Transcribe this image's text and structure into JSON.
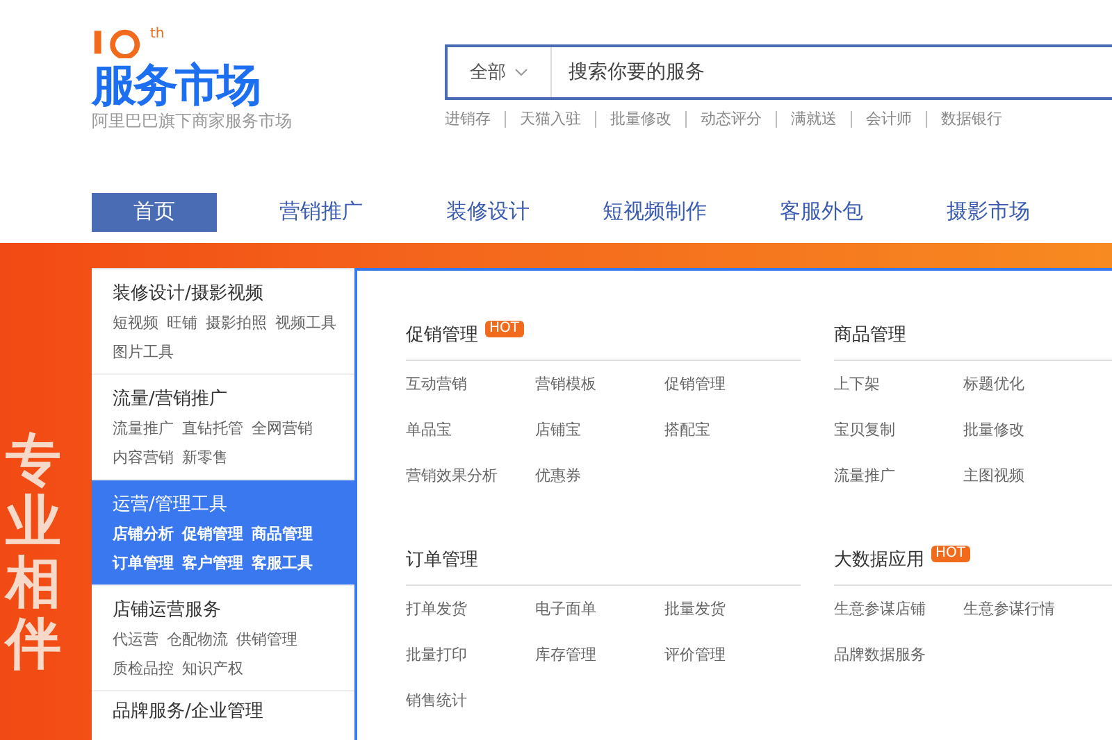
{
  "logo": {
    "title": "服务市场",
    "anniversary": "th",
    "subtitle": "阿里巴巴旗下商家服务市场"
  },
  "search": {
    "scope": "全部",
    "placeholder": "搜索你要的服务"
  },
  "hot_links": [
    "进销存",
    "天猫入驻",
    "批量修改",
    "动态评分",
    "满就送",
    "会计师",
    "数据银行"
  ],
  "nav": [
    {
      "label": "首页",
      "selected": true
    },
    {
      "label": "营销推广",
      "selected": false
    },
    {
      "label": "装修设计",
      "selected": false
    },
    {
      "label": "短视频制作",
      "selected": false
    },
    {
      "label": "客服外包",
      "selected": false
    },
    {
      "label": "摄影市场",
      "selected": false
    }
  ],
  "banner": {
    "slogan": "专业相伴"
  },
  "categories": [
    {
      "title": "装修设计/摄影视频",
      "selected": false,
      "links": [
        "短视频",
        "旺铺",
        "摄影拍照",
        "视频工具",
        "图片工具"
      ]
    },
    {
      "title": "流量/营销推广",
      "selected": false,
      "links": [
        "流量推广",
        "直钻托管",
        "全网营销",
        "内容营销",
        "新零售"
      ]
    },
    {
      "title": "运营/管理工具",
      "selected": true,
      "links": [
        "店铺分析",
        "促销管理",
        "商品管理",
        "订单管理",
        "客户管理",
        "客服工具"
      ]
    },
    {
      "title": "店铺运营服务",
      "selected": false,
      "links": [
        "代运营",
        "仓配物流",
        "供销管理",
        "质检品控",
        "知识产权"
      ]
    },
    {
      "title": "品牌服务/企业管理",
      "selected": false
    }
  ],
  "groups": [
    {
      "title": "促销管理",
      "badge": "HOT",
      "items": [
        "互动营销",
        "营销模板",
        "促销管理",
        "单品宝",
        "店铺宝",
        "搭配宝",
        "营销效果分析",
        "优惠券"
      ]
    },
    {
      "title": "商品管理",
      "items": [
        "上下架",
        "标题优化",
        "宝贝复制",
        "批量修改",
        "流量推广",
        "主图视频"
      ]
    },
    {
      "title": "订单管理",
      "items": [
        "打单发货",
        "电子面单",
        "批量发货",
        "批量打印",
        "库存管理",
        "评价管理",
        "销售统计"
      ]
    },
    {
      "title": "大数据应用",
      "badge": "HOT",
      "items": [
        "生意参谋店铺",
        "生意参谋行情",
        "品牌数据服务"
      ]
    }
  ]
}
